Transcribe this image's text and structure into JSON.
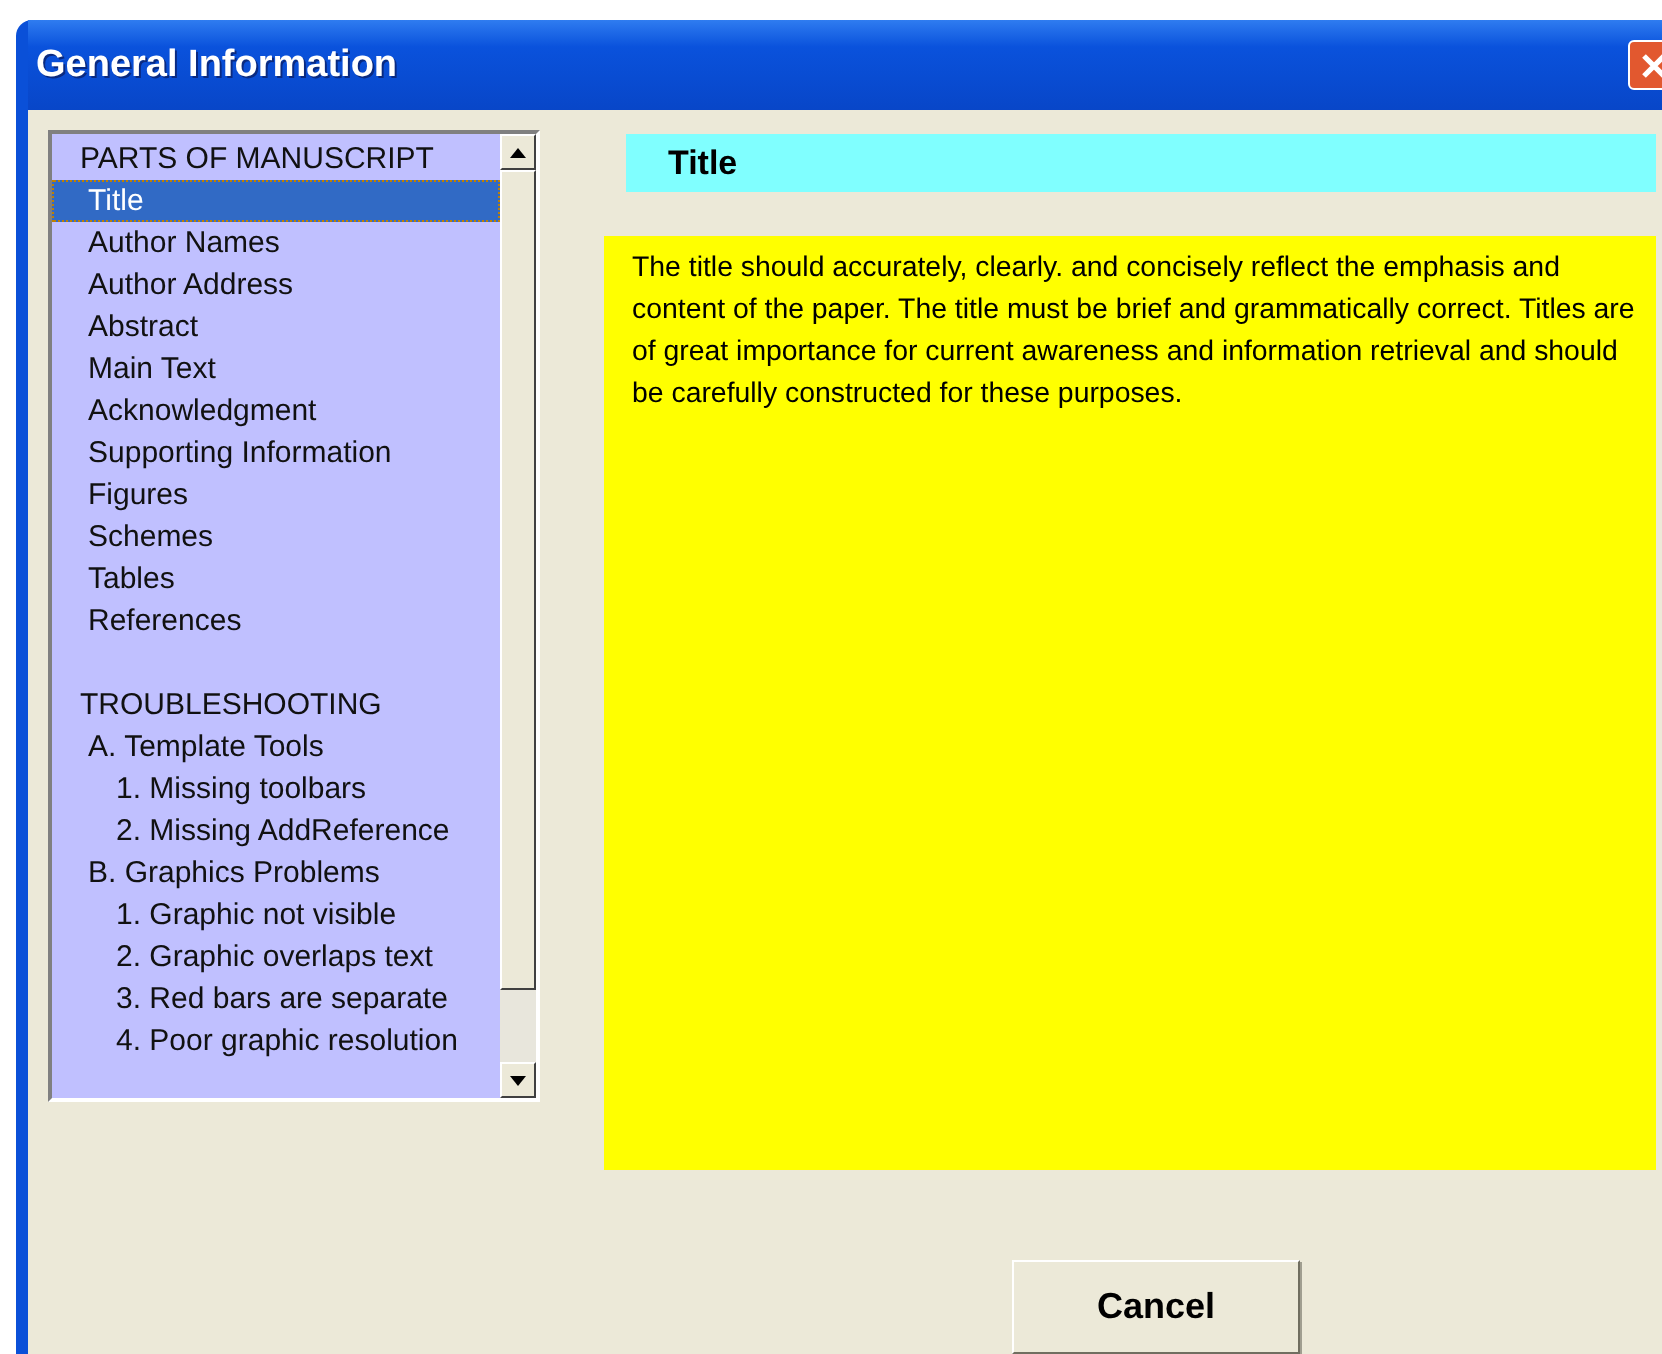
{
  "window": {
    "title": "General Information"
  },
  "sections": [
    {
      "heading": "PARTS OF MANUSCRIPT",
      "items": [
        {
          "label": "Title",
          "selected": true
        },
        {
          "label": "Author Names",
          "selected": false
        },
        {
          "label": "Author Address",
          "selected": false
        },
        {
          "label": "Abstract",
          "selected": false
        },
        {
          "label": "Main Text",
          "selected": false
        },
        {
          "label": "Acknowledgment",
          "selected": false
        },
        {
          "label": "Supporting Information",
          "selected": false
        },
        {
          "label": "Figures",
          "selected": false
        },
        {
          "label": "Schemes",
          "selected": false
        },
        {
          "label": "Tables",
          "selected": false
        },
        {
          "label": "References",
          "selected": false
        }
      ]
    },
    {
      "heading": "TROUBLESHOOTING",
      "items": [
        {
          "label": "A. Template Tools",
          "selected": false,
          "children": [
            {
              "label": "1. Missing toolbars",
              "selected": false
            },
            {
              "label": "2. Missing AddReference",
              "selected": false
            }
          ]
        },
        {
          "label": "B. Graphics Problems",
          "selected": false,
          "children": [
            {
              "label": "1. Graphic not visible",
              "selected": false
            },
            {
              "label": "2. Graphic overlaps text",
              "selected": false
            },
            {
              "label": "3. Red bars are separate",
              "selected": false
            },
            {
              "label": "4. Poor graphic resolution",
              "selected": false
            }
          ]
        }
      ]
    }
  ],
  "topic": {
    "heading": "Title",
    "body": "The title should accurately, clearly. and concisely reflect the emphasis and content of the paper. The title must be brief and grammatically correct. Titles are of great importance for current awareness and information retrieval and should be carefully constructed for these purposes."
  },
  "buttons": [
    "Cancel"
  ]
}
